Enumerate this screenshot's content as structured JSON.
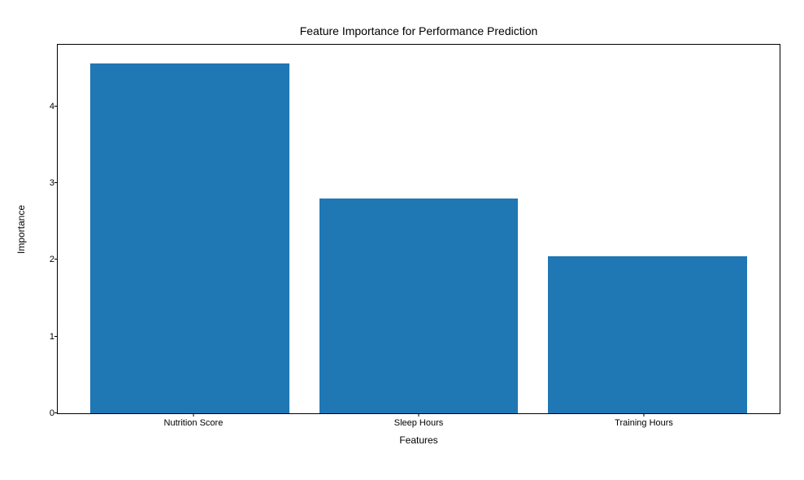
{
  "chart_data": {
    "type": "bar",
    "title": "Feature Importance for Performance Prediction",
    "xlabel": "Features",
    "ylabel": "Importance",
    "categories": [
      "Nutrition Score",
      "Sleep Hours",
      "Training Hours"
    ],
    "values": [
      4.56,
      2.8,
      2.04
    ],
    "ylim": [
      0,
      4.8
    ],
    "yticks": [
      0,
      1,
      2,
      3,
      4
    ],
    "bar_color": "#1f77b4"
  }
}
